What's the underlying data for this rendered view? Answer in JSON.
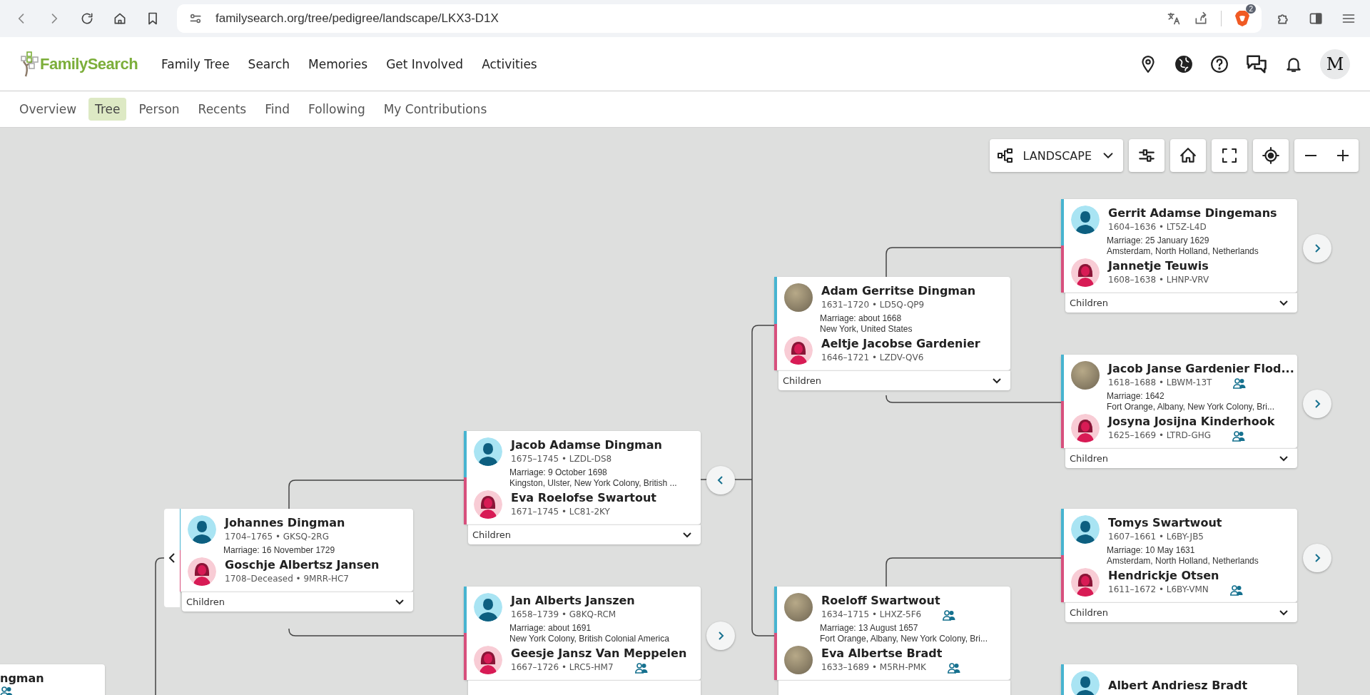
{
  "browser": {
    "url": "familysearch.org/tree/pedigree/landscape/LKX3-D1X",
    "shields_badge": "2"
  },
  "header": {
    "logo": "FamilySearch",
    "nav": [
      "Family Tree",
      "Search",
      "Memories",
      "Get Involved",
      "Activities"
    ],
    "avatar_letter": "M"
  },
  "subnav": [
    {
      "label": "Overview",
      "selected": false
    },
    {
      "label": "Tree",
      "selected": true
    },
    {
      "label": "Person",
      "selected": false
    },
    {
      "label": "Recents",
      "selected": false
    },
    {
      "label": "Find",
      "selected": false
    },
    {
      "label": "Following",
      "selected": false
    },
    {
      "label": "My Contributions",
      "selected": false
    }
  ],
  "toolbar": {
    "view": "LANDSCAPE"
  },
  "couples": [
    {
      "husband": {
        "name": "Gerrit Adamse Dingemans",
        "vitals": "1604–1636 • LT5Z-L4D",
        "avatar": {
          "kind": "male"
        },
        "relatives": false
      },
      "marriage": [
        "Marriage: 25 January 1629",
        "Amsterdam, North Holland, Netherlands"
      ],
      "wife": {
        "name": "Jannetje Teuwis",
        "vitals": "1608–1638 • LHNP-VRV",
        "avatar": {
          "kind": "female"
        },
        "relatives": false
      },
      "children": "Children",
      "nav_button": {
        "kind": "right"
      }
    },
    {
      "husband": {
        "name": "Adam Gerritse Dingman",
        "vitals": "1631–1720 • LD5Q-QP9",
        "avatar": {
          "kind": "photo"
        },
        "relatives": false
      },
      "marriage": [
        "Marriage: about 1668",
        "New York, United States"
      ],
      "wife": {
        "name": "Aeltje Jacobse Gardenier",
        "vitals": "1646–1721 • LZDV-QV6",
        "avatar": {
          "kind": "female"
        },
        "relatives": false
      },
      "children": "Children"
    },
    {
      "husband": {
        "name": "Jacob Janse Gardenier Flod...",
        "vitals": "1618–1688 • LBWM-13T",
        "avatar": {
          "kind": "photo"
        },
        "relatives": true
      },
      "marriage": [
        "Marriage: 1642",
        "Fort Orange, Albany, New York Colony, Bri..."
      ],
      "wife": {
        "name": "Josyna Josijna Kinderhook",
        "vitals": "1625–1669 • LTRD-GHG",
        "avatar": {
          "kind": "female"
        },
        "relatives": true
      },
      "children": "Children",
      "nav_button": {
        "kind": "right"
      }
    },
    {
      "husband": {
        "name": "Jacob Adamse Dingman",
        "vitals": "1675–1745 • LZDL-DS8",
        "avatar": {
          "kind": "male"
        },
        "relatives": false
      },
      "marriage": [
        "Marriage: 9 October 1698",
        "Kingston, Ulster, New York Colony, British ..."
      ],
      "wife": {
        "name": "Eva Roelofse Swartout",
        "vitals": "1671–1745 • LC81-2KY",
        "avatar": {
          "kind": "female"
        },
        "relatives": false
      },
      "children": "Children",
      "nav_button": {
        "kind": "left"
      }
    },
    {
      "husband": {
        "name": "Johannes Dingman",
        "vitals": "1704–1765 • GKSQ-2RG",
        "avatar": {
          "kind": "male"
        },
        "relatives": false
      },
      "marriage": [
        "Marriage: 16 November 1729"
      ],
      "wife": {
        "name": "Goschje Albertsz Jansen",
        "vitals": "1708–Deceased • 9MRR-HC7",
        "avatar": {
          "kind": "female"
        },
        "relatives": false
      },
      "children": "Children",
      "nav_button": {
        "kind": "back"
      }
    },
    {
      "husband": {
        "name": "Tomys Swartwout",
        "vitals": "1607–1661 • L6BY-JB5",
        "avatar": {
          "kind": "male"
        },
        "relatives": false
      },
      "marriage": [
        "Marriage: 10 May 1631",
        "Amsterdam, North Holland, Netherlands"
      ],
      "wife": {
        "name": "Hendrickje Otsen",
        "vitals": "1611–1672 • L6BY-VMN",
        "avatar": {
          "kind": "female"
        },
        "relatives": true
      },
      "children": "Children",
      "nav_button": {
        "kind": "right"
      }
    },
    {
      "husband": {
        "name": "Jan Alberts Janszen",
        "vitals": "1658–1739 • G8KQ-RCM",
        "avatar": {
          "kind": "male"
        },
        "relatives": false
      },
      "marriage": [
        "Marriage: about 1691",
        "New York Colony, British Colonial America"
      ],
      "wife": {
        "name": "Geesje Jansz Van Meppelen",
        "vitals": "1667–1726 • LRC5-HM7",
        "avatar": {
          "kind": "female"
        },
        "relatives": true
      },
      "nav_button": {
        "kind": "right"
      }
    },
    {
      "husband": {
        "name": "Roeloff Swartwout",
        "vitals": "1634–1715 • LHXZ-5F6",
        "avatar": {
          "kind": "photo"
        },
        "relatives": true
      },
      "marriage": [
        "Marriage: 13 August 1657",
        "Fort Orange, Albany, New York Colony, Bri..."
      ],
      "wife": {
        "name": "Eva Albertse Bradt",
        "vitals": "1633–1689 • M5RH-PMK",
        "avatar": {
          "kind": "photo"
        },
        "relatives": true
      }
    },
    {
      "husband": {
        "name": "Albert Andriesz Bradt",
        "avatar": {
          "kind": "male"
        },
        "relatives": false
      }
    },
    {
      "husband": {
        "name": "ngman",
        "relatives": true
      }
    }
  ]
}
